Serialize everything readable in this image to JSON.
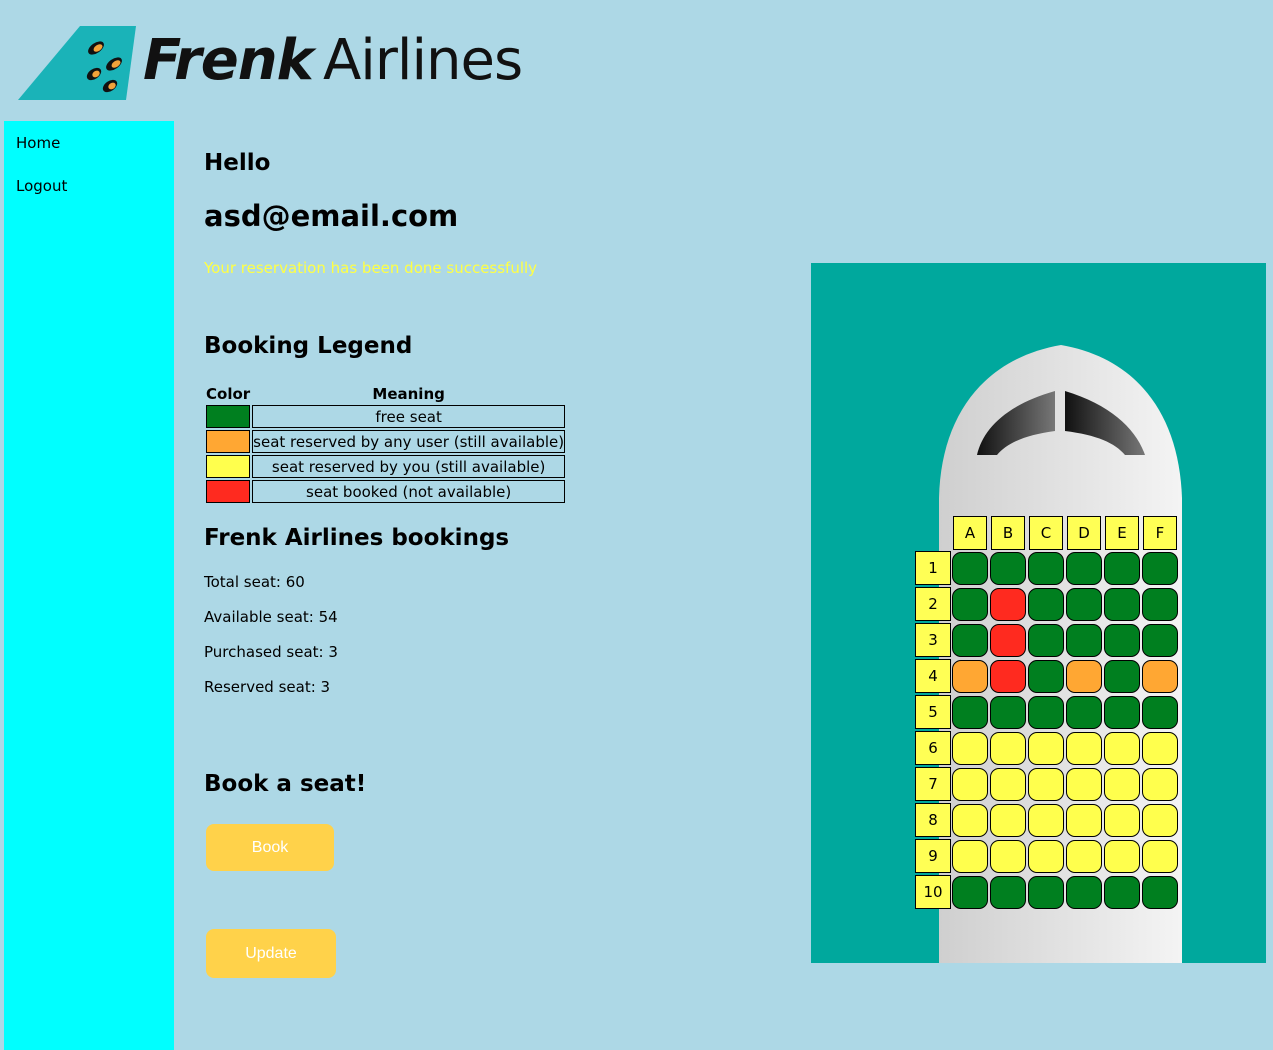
{
  "logo": {
    "brand_bold": "Frenk",
    "brand_light": "Airlines"
  },
  "nav": {
    "home": "Home",
    "logout": "Logout"
  },
  "greeting": {
    "hello": "Hello",
    "email": "asd@email.com",
    "message": "Your reservation has been done successfully"
  },
  "legend": {
    "title": "Booking Legend",
    "headers": {
      "color": "Color",
      "meaning": "Meaning"
    },
    "rows": [
      {
        "color": "#007f1f",
        "meaning": "free seat"
      },
      {
        "color": "#ffa733",
        "meaning": "seat reserved by any user (still available)"
      },
      {
        "color": "#ffff4d",
        "meaning": "seat reserved by you (still available)"
      },
      {
        "color": "#ff2a1f",
        "meaning": "seat booked (not available)"
      }
    ]
  },
  "bookings": {
    "title": "Frenk Airlines bookings",
    "total": "Total seat: 60",
    "available": "Available seat: 54",
    "purchased": "Purchased seat: 3",
    "reserved": "Reserved seat: 3"
  },
  "book": {
    "title": "Book a seat!",
    "book_label": "Book",
    "update_label": "Update"
  },
  "seatmap": {
    "columns": [
      "A",
      "B",
      "C",
      "D",
      "E",
      "F"
    ],
    "rows": [
      "1",
      "2",
      "3",
      "4",
      "5",
      "6",
      "7",
      "8",
      "9",
      "10"
    ],
    "status_colors": {
      "free": "#007f1f",
      "reserved_any": "#ffa733",
      "reserved_you": "#ffff4d",
      "booked": "#ff2a1f"
    },
    "seats": [
      [
        "free",
        "free",
        "free",
        "free",
        "free",
        "free"
      ],
      [
        "free",
        "booked",
        "free",
        "free",
        "free",
        "free"
      ],
      [
        "free",
        "booked",
        "free",
        "free",
        "free",
        "free"
      ],
      [
        "reserved_any",
        "booked",
        "free",
        "reserved_any",
        "free",
        "reserved_any"
      ],
      [
        "free",
        "free",
        "free",
        "free",
        "free",
        "free"
      ],
      [
        "reserved_you",
        "reserved_you",
        "reserved_you",
        "reserved_you",
        "reserved_you",
        "reserved_you"
      ],
      [
        "reserved_you",
        "reserved_you",
        "reserved_you",
        "reserved_you",
        "reserved_you",
        "reserved_you"
      ],
      [
        "reserved_you",
        "reserved_you",
        "reserved_you",
        "reserved_you",
        "reserved_you",
        "reserved_you"
      ],
      [
        "reserved_you",
        "reserved_you",
        "reserved_you",
        "reserved_you",
        "reserved_you",
        "reserved_you"
      ],
      [
        "free",
        "free",
        "free",
        "free",
        "free",
        "free"
      ]
    ]
  }
}
